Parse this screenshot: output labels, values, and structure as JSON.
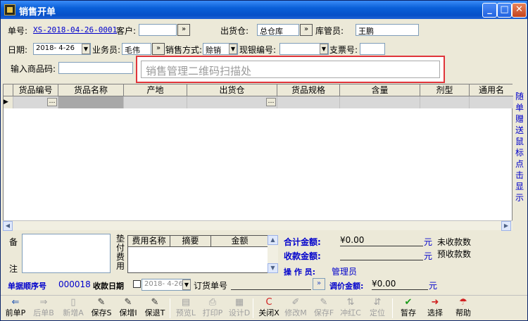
{
  "window": {
    "title": "销售开单"
  },
  "header": {
    "order_no_label": "单号:",
    "order_no": "XS-2018-04-26-0001",
    "customer_label": "客户:",
    "customer_value": "",
    "warehouse_label": "出货仓:",
    "warehouse_value": "总仓库",
    "keeper_label": "库管员:",
    "keeper_value": "王鹏",
    "date_label": "日期:",
    "date_value": "2018- 4-26",
    "salesman_label": "业务员:",
    "salesman_value": "毛伟",
    "sale_method_label": "销售方式:",
    "sale_method_value": "赊销",
    "cash_no_label": "现银编号:",
    "cash_no_value": "",
    "check_no_label": "支票号:",
    "check_no_value": "",
    "product_code_label": "输入商品码:",
    "product_code_value": "",
    "scan_placeholder": "销售管理二维码扫描处"
  },
  "grid": {
    "columns": [
      "货品编号",
      "货品名称",
      "产地",
      "出货仓",
      "货品规格",
      "含量",
      "剂型",
      "通用名"
    ],
    "side_text": "随单赠送鼠标点击显示"
  },
  "bottom": {
    "remark_label_top": "备",
    "remark_label_bottom": "注",
    "fee_label": "垫付费用",
    "fee_columns": [
      "费用名称",
      "摘要",
      "金额"
    ],
    "total_label": "合计金额:",
    "total_value": "¥0.00",
    "total_unit": "元",
    "unreceived_label": "未收款数",
    "received_label": "收款金额:",
    "received_value": "",
    "received_unit": "元",
    "prepay_label": "预收款数",
    "operator_label": "操 作 员:",
    "operator_value": "管理员",
    "seq_label": "单据顺序号",
    "seq_value": "000018",
    "receive_date_label": "收款日期",
    "receive_date_value": "2018- 4-26",
    "order_ref_label": "订货单号",
    "order_ref_value": "",
    "adjust_label": "调价金额:",
    "adjust_value": "¥0.00",
    "adjust_unit": "元"
  },
  "toolbar": {
    "buttons": [
      {
        "label": "前单P",
        "icon": "arrow-left-icon",
        "glyph": "⇐",
        "enabled": true
      },
      {
        "label": "后单B",
        "icon": "arrow-right-icon",
        "glyph": "⇒",
        "enabled": false
      },
      {
        "label": "新增A",
        "icon": "new-doc-icon",
        "glyph": "▯",
        "enabled": false
      },
      {
        "label": "保存S",
        "icon": "save-icon",
        "glyph": "✎",
        "enabled": true
      },
      {
        "label": "保增I",
        "icon": "save-new-icon",
        "glyph": "✎",
        "enabled": true
      },
      {
        "label": "保退T",
        "icon": "save-exit-icon",
        "glyph": "✎",
        "enabled": true
      },
      {
        "label": "预览L",
        "icon": "preview-icon",
        "glyph": "▤",
        "enabled": false
      },
      {
        "label": "打印P",
        "icon": "print-icon",
        "glyph": "⎙",
        "enabled": false
      },
      {
        "label": "设计D",
        "icon": "design-icon",
        "glyph": "▦",
        "enabled": false
      },
      {
        "label": "关闭X",
        "icon": "close-icon",
        "glyph": "C",
        "enabled": true
      },
      {
        "label": "修改M",
        "icon": "edit-icon",
        "glyph": "✐",
        "enabled": false
      },
      {
        "label": "保存F",
        "icon": "save-disabled-icon",
        "glyph": "✎",
        "enabled": false
      },
      {
        "label": "冲红C",
        "icon": "reverse-icon",
        "glyph": "⇅",
        "enabled": false
      },
      {
        "label": "定位",
        "icon": "locate-icon",
        "glyph": "⇵",
        "enabled": false
      },
      {
        "label": "暂存",
        "icon": "temp-save-icon",
        "glyph": "✔",
        "enabled": true
      },
      {
        "label": "选择",
        "icon": "select-icon",
        "glyph": "➜",
        "enabled": true
      },
      {
        "label": "帮助",
        "icon": "help-icon",
        "glyph": "☂",
        "enabled": true
      }
    ]
  }
}
